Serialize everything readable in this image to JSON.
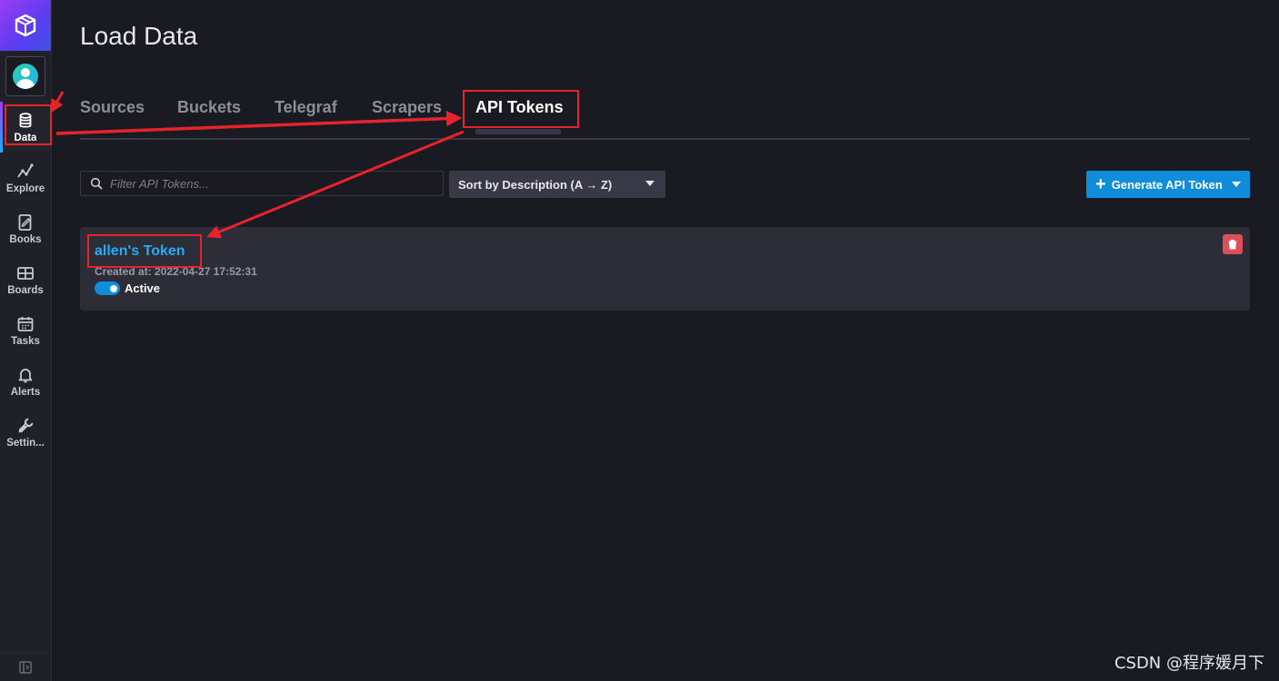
{
  "page": {
    "title": "Load Data"
  },
  "sidebar": {
    "items": [
      {
        "label": "Data",
        "icon": "database-icon",
        "active": true
      },
      {
        "label": "Explore",
        "icon": "graph-icon"
      },
      {
        "label": "Books",
        "icon": "notebook-icon"
      },
      {
        "label": "Boards",
        "icon": "dashboard-icon"
      },
      {
        "label": "Tasks",
        "icon": "calendar-icon"
      },
      {
        "label": "Alerts",
        "icon": "bell-icon"
      },
      {
        "label": "Settin...",
        "icon": "wrench-icon"
      }
    ]
  },
  "tabs": [
    {
      "label": "Sources"
    },
    {
      "label": "Buckets"
    },
    {
      "label": "Telegraf"
    },
    {
      "label": "Scrapers"
    },
    {
      "label": "API Tokens",
      "active": true
    }
  ],
  "toolbar": {
    "search_placeholder": "Filter API Tokens...",
    "sort_label": "Sort by Description (A → Z)",
    "generate_label": "Generate API Token"
  },
  "tokens": [
    {
      "name": "allen's Token",
      "created": "Created at: 2022-04-27 17:52:31",
      "status_label": "Active",
      "active": true
    }
  ],
  "watermark": "CSDN @程序媛月下",
  "colors": {
    "accent": "#0f8ddb",
    "link": "#22adf6",
    "danger": "#dc4e58",
    "annotation": "#e8232b"
  }
}
